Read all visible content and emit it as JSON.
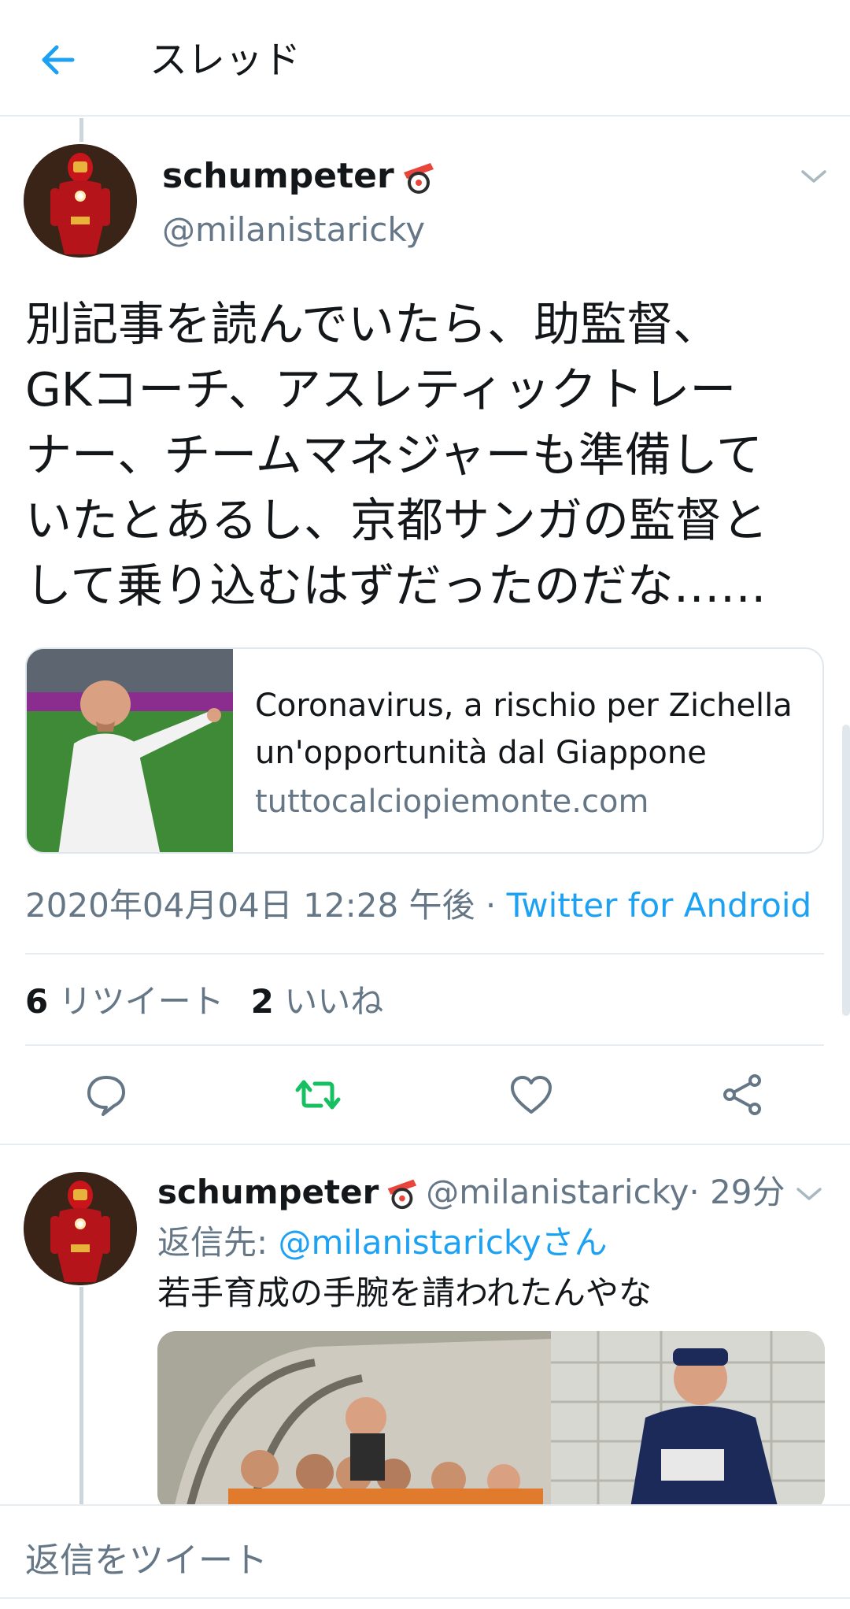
{
  "header": {
    "title": "スレッド"
  },
  "main_tweet": {
    "name": "schumpeter",
    "handle": "@milanistaricky",
    "text": "別記事を読んでいたら、助監督、\nGKコーチ、アスレティックトレー\nナー、チームマネジャーも準備して\nいたとあるし、京都サンガの監督と\nして乗り込むはずだったのだな……",
    "card": {
      "title": "Coronavirus, a rischio per Zichella un'opportunità dal Giappone",
      "domain": "tuttocalciopiemonte.com"
    },
    "timestamp": "2020年04月04日 12:28 午後",
    "separator": " · ",
    "source": "Twitter for Android",
    "retweets": {
      "count": "6",
      "label": "リツイート"
    },
    "likes": {
      "count": "2",
      "label": "いいね"
    }
  },
  "reply_tweet": {
    "name": "schumpeter",
    "handle": "@milanistaricky",
    "time": " · 29分",
    "reply_to_prefix": "返信先: ",
    "reply_to_mention": "@milanistarickyさん",
    "text": "若手育成の手腕を請われたんやな"
  },
  "compose": {
    "placeholder": "返信をツイート"
  },
  "colors": {
    "accent": "#1da1f2",
    "retweet_green": "#17bf63",
    "secondary_text": "#657786"
  },
  "icons": [
    "back-arrow-icon",
    "sushi-emoji-icon",
    "chevron-down-icon",
    "reply-icon",
    "retweet-icon",
    "like-icon",
    "share-icon"
  ]
}
